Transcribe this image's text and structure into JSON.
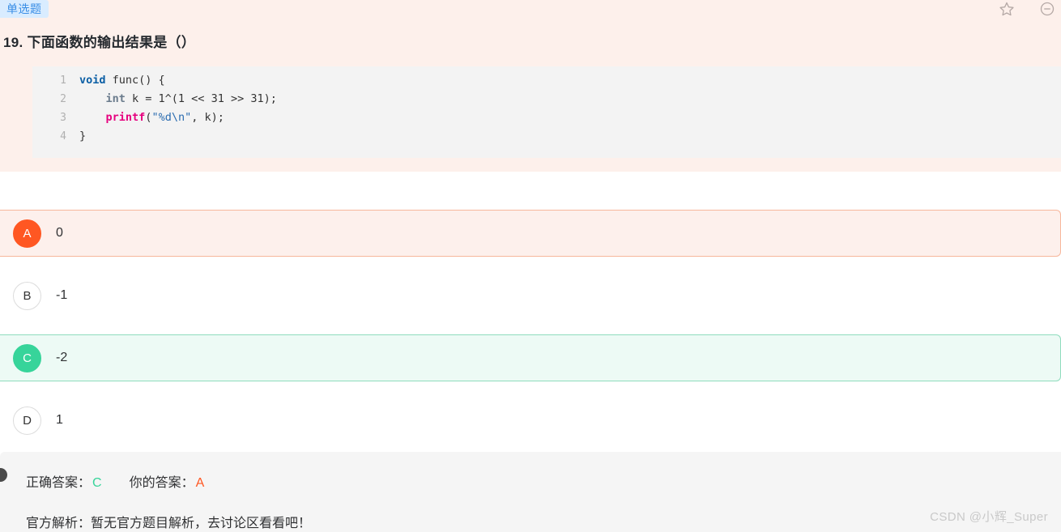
{
  "header": {
    "tag": "单选题",
    "title": "19. 下面函数的输出结果是（）",
    "icons": {
      "favorite": "star-icon",
      "collapse": "circle-minus-icon"
    }
  },
  "code": {
    "language": "c",
    "lines": [
      {
        "number": "1",
        "tokens": [
          {
            "text": "void",
            "type": "keyword-void"
          },
          {
            "text": " func() {",
            "type": "plain"
          }
        ]
      },
      {
        "number": "2",
        "tokens": [
          {
            "text": "    ",
            "type": "plain"
          },
          {
            "text": "int",
            "type": "keyword-int"
          },
          {
            "text": " k = 1^(1 << 31 >> 31);",
            "type": "plain"
          }
        ]
      },
      {
        "number": "3",
        "tokens": [
          {
            "text": "    ",
            "type": "plain"
          },
          {
            "text": "printf",
            "type": "function"
          },
          {
            "text": "(",
            "type": "plain"
          },
          {
            "text": "\"%d\\n\"",
            "type": "string"
          },
          {
            "text": ", k);",
            "type": "plain"
          }
        ]
      },
      {
        "number": "4",
        "tokens": [
          {
            "text": "}",
            "type": "plain"
          }
        ]
      }
    ]
  },
  "options": [
    {
      "letter": "A",
      "text": "0",
      "state": "selected-wrong"
    },
    {
      "letter": "B",
      "text": "-1",
      "state": "plain"
    },
    {
      "letter": "C",
      "text": "-2",
      "state": "correct"
    },
    {
      "letter": "D",
      "text": "1",
      "state": "plain"
    }
  ],
  "answer": {
    "correct_label": "正确答案：",
    "correct_value": "C",
    "your_label": "你的答案：",
    "your_value": "A",
    "explanation_label": "官方解析：",
    "explanation_text": "暂无官方题目解析，去讨论区看看吧！"
  },
  "watermark": "CSDN @小辉_Super",
  "colors": {
    "question_bg": "#fdf0eb",
    "tag_bg": "#d9ecff",
    "tag_text": "#3a8ee6",
    "code_bg": "#f3f3f3",
    "wrong": "#ff5722",
    "correct": "#37d49a",
    "panel_bg": "#f5f5f5"
  }
}
